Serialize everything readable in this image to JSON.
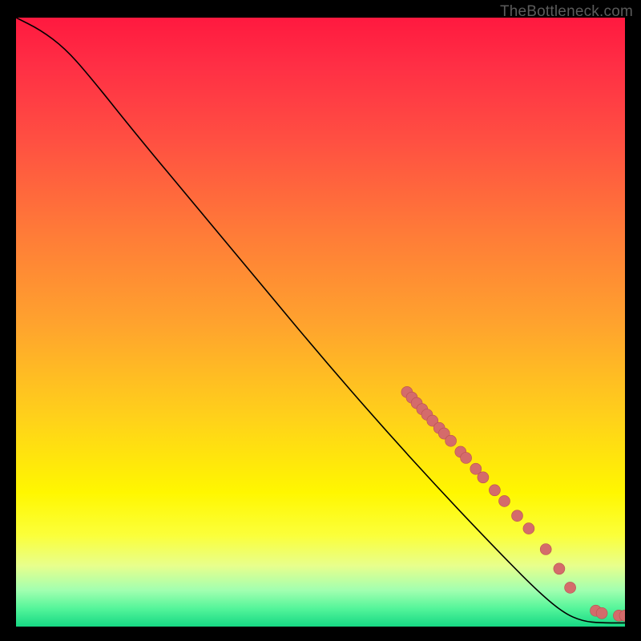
{
  "attribution": "TheBottleneck.com",
  "colors": {
    "marker_fill": "#d46b6b",
    "marker_stroke": "#b94f4f",
    "curve": "#000000",
    "frame_bg": "#000000"
  },
  "chart_data": {
    "type": "line",
    "title": "",
    "xlabel": "",
    "ylabel": "",
    "xlim": [
      0,
      100
    ],
    "ylim": [
      0,
      100
    ],
    "grid": false,
    "curve": [
      {
        "x": 0,
        "y": 100
      },
      {
        "x": 4,
        "y": 98
      },
      {
        "x": 8,
        "y": 95
      },
      {
        "x": 12,
        "y": 90.5
      },
      {
        "x": 20,
        "y": 80.5
      },
      {
        "x": 30,
        "y": 68.5
      },
      {
        "x": 40,
        "y": 56.5
      },
      {
        "x": 50,
        "y": 44.5
      },
      {
        "x": 60,
        "y": 33
      },
      {
        "x": 70,
        "y": 22
      },
      {
        "x": 80,
        "y": 11.5
      },
      {
        "x": 86,
        "y": 5.5
      },
      {
        "x": 90,
        "y": 2.2
      },
      {
        "x": 93,
        "y": 0.9
      },
      {
        "x": 96,
        "y": 0.6
      },
      {
        "x": 100,
        "y": 0.6
      }
    ],
    "markers": [
      {
        "x": 64.2,
        "y": 38.5
      },
      {
        "x": 65.0,
        "y": 37.6
      },
      {
        "x": 65.8,
        "y": 36.7
      },
      {
        "x": 66.7,
        "y": 35.7
      },
      {
        "x": 67.5,
        "y": 34.8
      },
      {
        "x": 68.4,
        "y": 33.8
      },
      {
        "x": 69.5,
        "y": 32.6
      },
      {
        "x": 70.3,
        "y": 31.7
      },
      {
        "x": 71.4,
        "y": 30.5
      },
      {
        "x": 73.0,
        "y": 28.7
      },
      {
        "x": 73.9,
        "y": 27.7
      },
      {
        "x": 75.5,
        "y": 25.9
      },
      {
        "x": 76.7,
        "y": 24.5
      },
      {
        "x": 78.6,
        "y": 22.4
      },
      {
        "x": 80.2,
        "y": 20.6
      },
      {
        "x": 82.3,
        "y": 18.2
      },
      {
        "x": 84.2,
        "y": 16.1
      },
      {
        "x": 87.0,
        "y": 12.7
      },
      {
        "x": 89.2,
        "y": 9.5
      },
      {
        "x": 91.0,
        "y": 6.4
      },
      {
        "x": 95.2,
        "y": 2.6
      },
      {
        "x": 96.2,
        "y": 2.2
      },
      {
        "x": 99.0,
        "y": 1.8
      },
      {
        "x": 100.0,
        "y": 1.8
      }
    ],
    "marker_radius": 7
  }
}
